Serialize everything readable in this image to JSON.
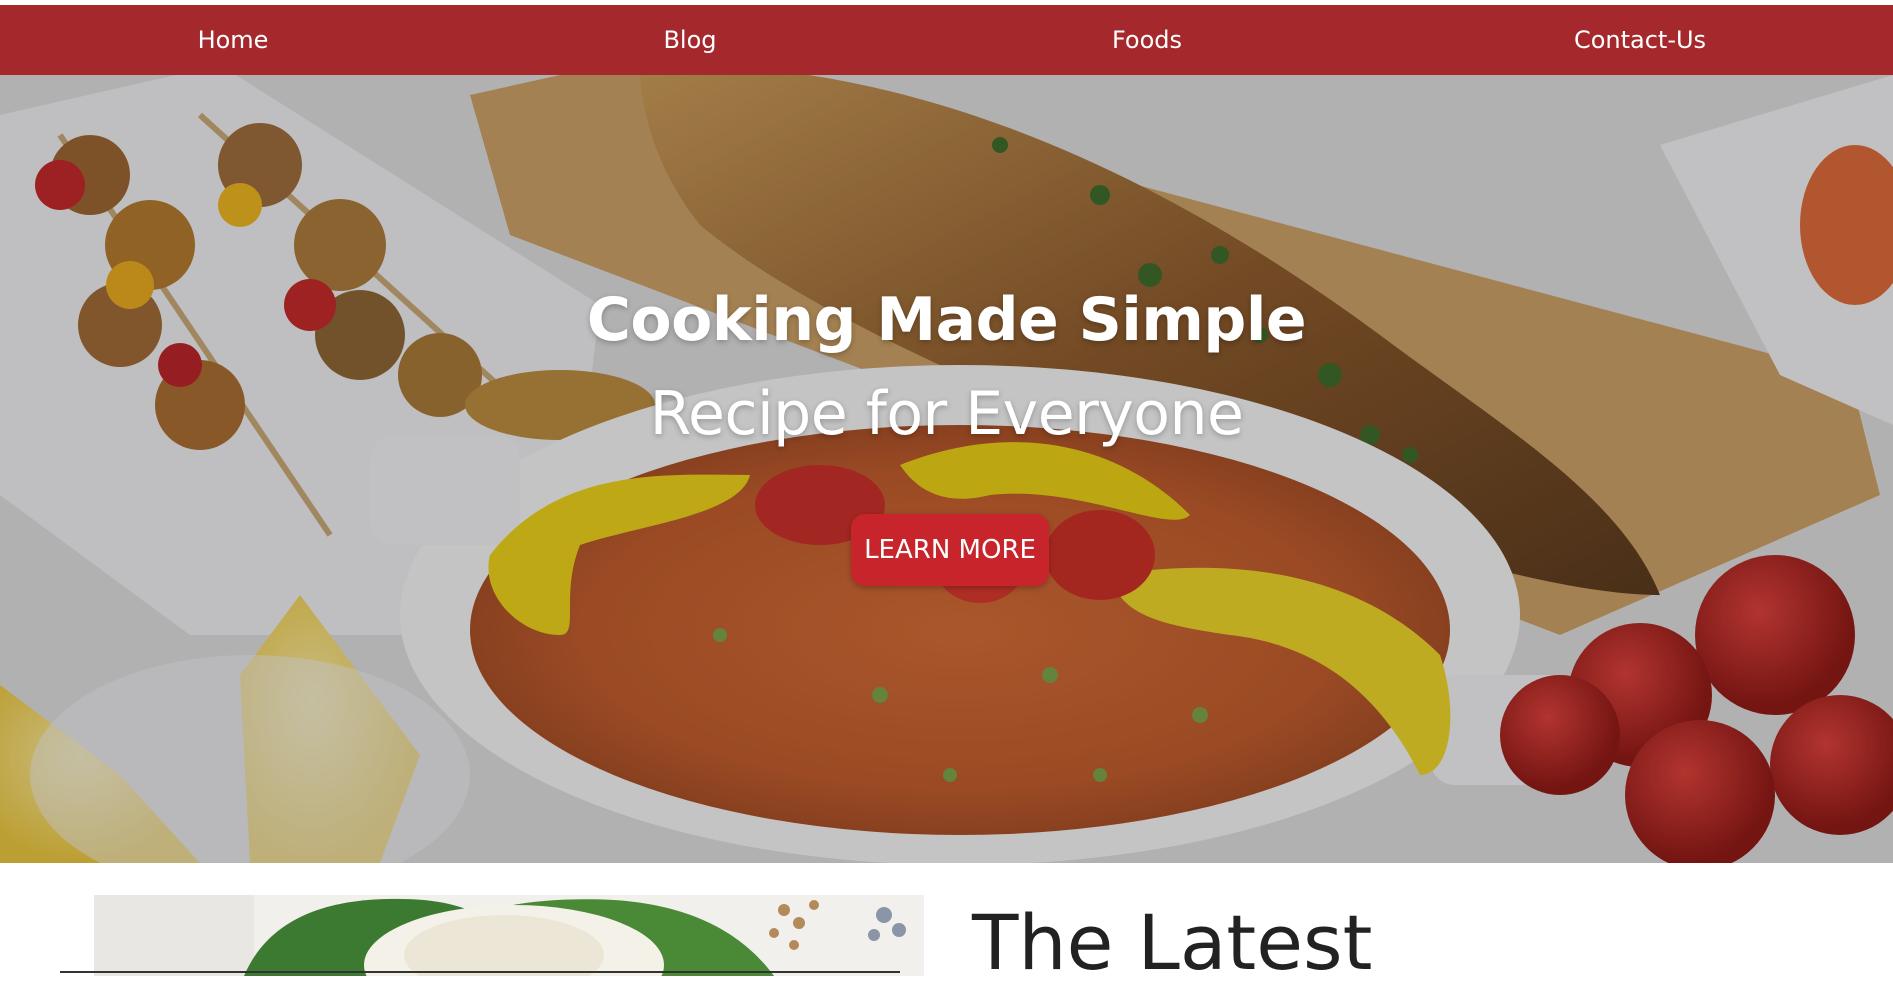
{
  "nav": {
    "items": [
      {
        "label": "Home"
      },
      {
        "label": "Blog"
      },
      {
        "label": "Foods"
      },
      {
        "label": "Contact-Us"
      }
    ],
    "background_color": "#a5292c"
  },
  "hero": {
    "title": "Cooking Made Simple",
    "subtitle": "Recipe for Everyone",
    "cta_label": "LEARN MORE",
    "cta_color": "#c8242c"
  },
  "latest": {
    "title": "The Latest"
  }
}
